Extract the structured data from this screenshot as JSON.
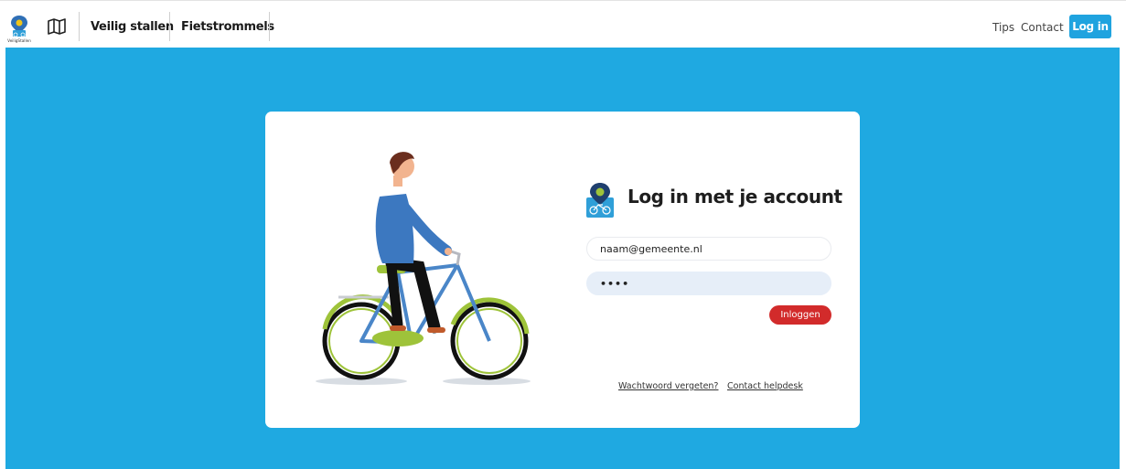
{
  "header": {
    "logo_text": "VeiligStallen",
    "nav": [
      "Veilig stallen",
      "Fietstrommels"
    ],
    "right_links": [
      "Tips",
      "Contact"
    ],
    "login_button": "Log in"
  },
  "login_card": {
    "title": "Log in met je account",
    "email_value": "naam@gemeente.nl",
    "password_masked": "••••",
    "submit_label": "Inloggen",
    "links": [
      "Wachtwoord vergeten?",
      "Contact helpdesk"
    ]
  },
  "colors": {
    "accent": "#1fa9e1",
    "button_blue": "#1fa3df",
    "submit_red": "#d22b2b",
    "card_bg": "#ffffff"
  },
  "icons": [
    "veiligstallen-logo-icon",
    "map-icon",
    "veiligstallen-card-logo-icon"
  ]
}
